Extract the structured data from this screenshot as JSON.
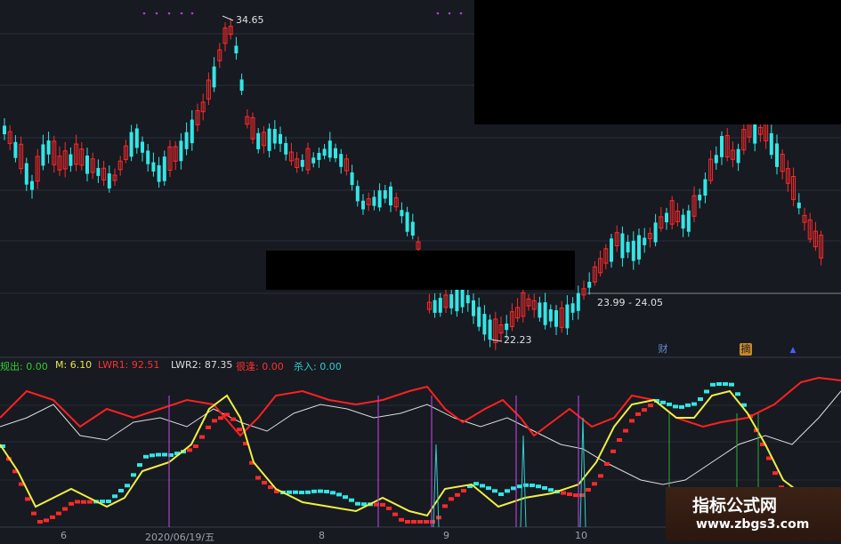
{
  "price_labels": {
    "high": "34.65",
    "low": "22.23",
    "range": "23.99 - 24.05"
  },
  "indicator": {
    "items": [
      {
        "text": "规出: 0.00",
        "color": "#33cc33"
      },
      {
        "text": "M: 6.10",
        "color": "#e8e84a"
      },
      {
        "text": "LWR1: 92.51",
        "color": "#ff3030"
      },
      {
        "text": "LWR2: 87.35",
        "color": "#dddddd"
      },
      {
        "text": "很逢: 0.00",
        "color": "#ff3030"
      },
      {
        "text": "杀入: 0.00",
        "color": "#33cccc"
      }
    ]
  },
  "badges": {
    "cai": "财",
    "event": "摘",
    "arrow": "▲"
  },
  "x_axis": {
    "labels": [
      "6",
      "2020/06/19/五",
      "8",
      "9",
      "10"
    ]
  },
  "watermark": {
    "title": "指标公式网",
    "url": "www.zbgs3.com"
  },
  "colors": {
    "background": "#171a21",
    "up": "#ff2a2a",
    "down": "#33e6e6",
    "lwr1": "#ff2020",
    "lwr2": "#dddddd",
    "m": "#f0f040",
    "vline": "#b040d0"
  }
}
